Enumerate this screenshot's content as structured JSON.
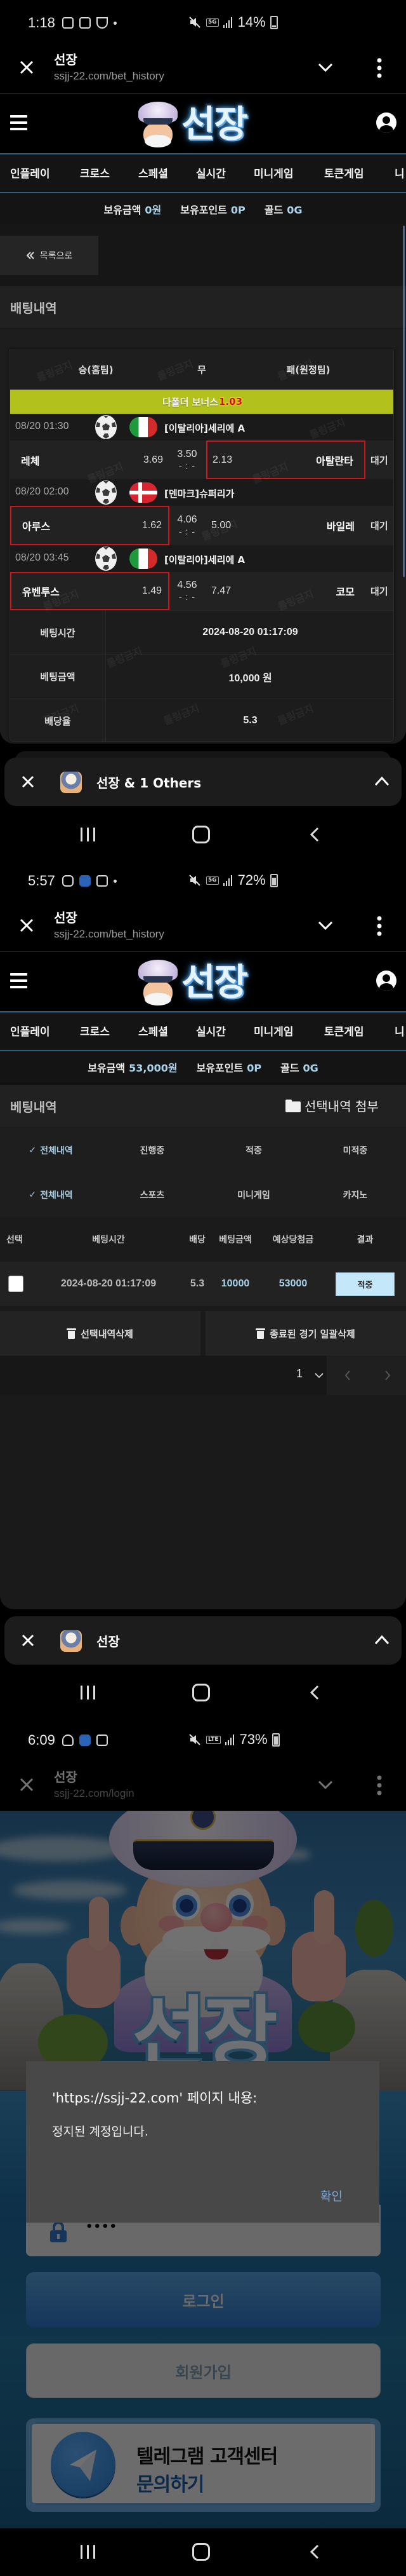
{
  "theme": {
    "accent_line": "#2f5e7e",
    "value_blue": "#a9d3ea",
    "bonus_bar": "#b3c11d",
    "bonus_value": "#c8150f",
    "pick_highlight": "#d0141a",
    "result_hit_bg": "#c5e7fa",
    "dialog_button": "#7ea6d4",
    "telegram_blue": "#1b5ca6"
  },
  "site": {
    "logo_text": "선장",
    "nav": [
      "인플레이",
      "크로스",
      "스페셜",
      "실시간",
      "미니게임",
      "토큰게임",
      "니"
    ],
    "watermark": "롤링금지"
  },
  "screens": [
    {
      "status_bar": {
        "time": "1:18",
        "network": "5G",
        "battery": "14%"
      },
      "browser": {
        "title": "선장",
        "url": "ssjj-22.com/bet_history"
      },
      "balance": {
        "money_label": "보유금액",
        "money_value": "0원",
        "points_label": "보유포인트",
        "points_value": "0P",
        "gold_label": "골드",
        "gold_value": "0G"
      },
      "back_button": "목록으로",
      "section_title": "배팅내역",
      "slip": {
        "columns": [
          "승(홈팀)",
          "무",
          "패(원정팀)"
        ],
        "bonus_label": "다폴더 보너스",
        "bonus_value": "1.03",
        "matches": [
          {
            "time": "08/20 01:30",
            "sport": "soccer",
            "country": "italy",
            "league": "[이탈리아]세리에 A",
            "home": "레체",
            "home_odds": "3.69",
            "draw_odds": "3.50",
            "score": "- : -",
            "away_odds": "2.13",
            "away": "아탈란타",
            "status": "대기",
            "selected": "away"
          },
          {
            "time": "08/20 02:00",
            "sport": "soccer",
            "country": "denmark",
            "league": "[덴마크]슈퍼리가",
            "home": "아루스",
            "home_odds": "1.62",
            "draw_odds": "4.06",
            "score": "- : -",
            "away_odds": "5.00",
            "away": "바일레",
            "status": "대기",
            "selected": "home"
          },
          {
            "time": "08/20 03:45",
            "sport": "soccer",
            "country": "italy",
            "league": "[이탈리아]세리에 A",
            "home": "유벤투스",
            "home_odds": "1.49",
            "draw_odds": "4.56",
            "score": "- : -",
            "away_odds": "7.47",
            "away": "코모",
            "status": "대기",
            "selected": "home"
          }
        ],
        "details": [
          {
            "label": "베팅시간",
            "value": "2024-08-20 01:17:09"
          },
          {
            "label": "베팅금액",
            "value": "10,000 원"
          },
          {
            "label": "배당율",
            "value": "5.3"
          }
        ]
      },
      "popup_bar": {
        "title": "선장 & 1 Others"
      }
    },
    {
      "status_bar": {
        "time": "5:57",
        "network": "5G",
        "battery": "72%"
      },
      "browser": {
        "title": "선장",
        "url": "ssjj-22.com/bet_history"
      },
      "balance": {
        "money_label": "보유금액",
        "money_value": "53,000원",
        "points_label": "보유포인트",
        "points_value": "0P",
        "gold_label": "골드",
        "gold_value": "0G"
      },
      "section_title": "베팅내역",
      "attach_button": "선택내역 첨부",
      "filters": {
        "status": [
          {
            "label": "전체내역",
            "active": true
          },
          {
            "label": "진행중"
          },
          {
            "label": "적중"
          },
          {
            "label": "미적중"
          }
        ],
        "category": [
          {
            "label": "전체내역",
            "active": true
          },
          {
            "label": "스포츠"
          },
          {
            "label": "미니게임"
          },
          {
            "label": "카지노"
          }
        ]
      },
      "table": {
        "headers": [
          "선택",
          "베팅시간",
          "배당",
          "베팅금액",
          "예상당첨금",
          "결과"
        ],
        "rows": [
          {
            "checked": false,
            "time": "2024-08-20 01:17:09",
            "odds": "5.3",
            "amount": "10000",
            "payout": "53000",
            "result": "적중"
          }
        ]
      },
      "actions": {
        "delete_selected": "선택내역삭제",
        "delete_finished": "종료된 경기 일괄삭제"
      },
      "pagination": {
        "page": "1"
      },
      "popup_bar": {
        "title": "선장"
      }
    },
    {
      "status_bar": {
        "time": "6:09",
        "network": "LTE",
        "battery": "73%"
      },
      "browser": {
        "title": "선장",
        "url": "ssjj-22.com/login"
      },
      "login": {
        "logo_text": "선장",
        "password_value": "••••",
        "login_button": "로그인",
        "signup_button": "회원가입",
        "telegram_line1": "텔레그램 고객센터",
        "telegram_line2": "문의하기"
      },
      "dialog": {
        "title": "'https://ssjj-22.com' 페이지 내용:",
        "message": "정지된 계정입니다.",
        "ok_button": "확인"
      }
    }
  ]
}
